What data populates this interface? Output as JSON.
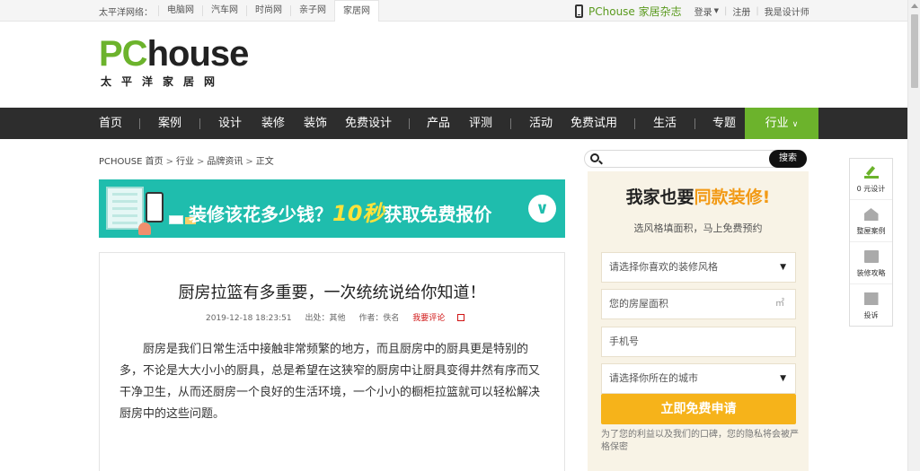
{
  "topbar": {
    "lead": "太平洋网络：",
    "links": [
      "电脑网",
      "汽车网",
      "时尚网",
      "亲子网",
      "家居网"
    ],
    "magazine": "PChouse 家居杂志",
    "login": "登录",
    "register": "注册",
    "designer": "我是设计师"
  },
  "logo": {
    "pc": "PC",
    "house": "house",
    "cn": "太平洋家居网"
  },
  "nav": {
    "items": [
      "首页",
      "案例",
      "设计",
      "装修",
      "装饰",
      "免费设计",
      "产品",
      "评测",
      "活动",
      "免费试用",
      "生活",
      "专题"
    ],
    "active": "行业"
  },
  "breadcrumb": {
    "home": "PCHOUSE 首页",
    "c1": "行业",
    "c2": "品牌资讯",
    "c3": "正文"
  },
  "banner": {
    "text_pre": "装修该花多少钱？",
    "text_hi": "10秒",
    "text_post": "获取免费报价",
    "button": "∨"
  },
  "article": {
    "title": "厨房拉篮有多重要，一次统统说给你知道！",
    "date": "2019-12-18 18:23:51",
    "source": "出处：其他",
    "author": "作者：佚名",
    "comment": "我要评论",
    "body": "厨房是我们日常生活中接触非常频繁的地方，而且厨房中的厨具更是特别的多，不论是大大小小的厨具，总是希望在这狭窄的厨房中让厨具变得井然有序而又干净卫生，从而还厨房一个良好的生活环境，一个小小的橱柜拉篮就可以轻松解决厨房中的这些问题。"
  },
  "search": {
    "button": "搜索",
    "placeholder": ""
  },
  "panel": {
    "title_pre": "我家也要",
    "title_hi": "同款装修",
    "title_post": "!",
    "subtitle": "选风格填面积，马上免费预约",
    "style_select": "请选择你喜欢的装修风格",
    "area_field": "您的房屋面积",
    "area_unit": "㎡",
    "phone_field": "手机号",
    "city_select": "请选择你所在的城市",
    "submit": "立即免费申请",
    "note": "为了您的利益以及我们的口碑，您的隐私将会被严格保密"
  },
  "float": {
    "items": [
      {
        "label": "0 元设计",
        "icon": "pencil-icon"
      },
      {
        "label": "整屋案例",
        "icon": "house-icon"
      },
      {
        "label": "装修攻略",
        "icon": "book-icon"
      },
      {
        "label": "投诉",
        "icon": "mail-icon"
      }
    ]
  },
  "colors": {
    "brand_green": "#6cb32c",
    "nav_bg": "#2d2d2d",
    "banner_teal": "#1fbdad",
    "submit_orange": "#f6b31a",
    "panel_bg": "#f8f3e6"
  }
}
